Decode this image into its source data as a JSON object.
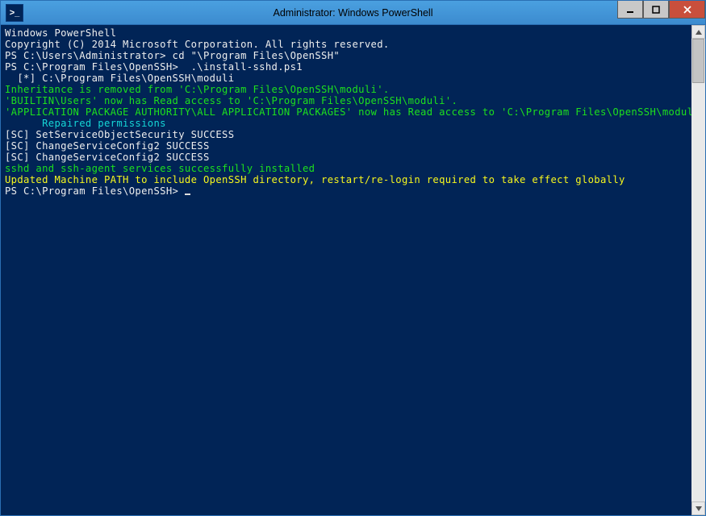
{
  "window": {
    "title": "Administrator: Windows PowerShell",
    "icon_glyph": ">_"
  },
  "terminal": {
    "lines": [
      {
        "cls": "l-white",
        "text": "Windows PowerShell"
      },
      {
        "cls": "l-white",
        "text": "Copyright (C) 2014 Microsoft Corporation. All rights reserved."
      },
      {
        "cls": "l-white",
        "text": ""
      },
      {
        "cls": "l-white",
        "text": "PS C:\\Users\\Administrator> cd \"\\Program Files\\OpenSSH\""
      },
      {
        "cls": "l-white",
        "text": "PS C:\\Program Files\\OpenSSH>  .\\install-sshd.ps1"
      },
      {
        "cls": "l-white",
        "text": "  [*] C:\\Program Files\\OpenSSH\\moduli"
      },
      {
        "cls": "l-green",
        "text": "Inheritance is removed from 'C:\\Program Files\\OpenSSH\\moduli'."
      },
      {
        "cls": "l-green",
        "text": "'BUILTIN\\Users' now has Read access to 'C:\\Program Files\\OpenSSH\\moduli'."
      },
      {
        "cls": "l-green",
        "text": "'APPLICATION PACKAGE AUTHORITY\\ALL APPLICATION PACKAGES' now has Read access to 'C:\\Program Files\\OpenSSH\\moduli'."
      },
      {
        "cls": "l-cyan",
        "text": "      Repaired permissions"
      },
      {
        "cls": "l-white",
        "text": ""
      },
      {
        "cls": "l-white",
        "text": "[SC] SetServiceObjectSecurity SUCCESS"
      },
      {
        "cls": "l-white",
        "text": "[SC] ChangeServiceConfig2 SUCCESS"
      },
      {
        "cls": "l-white",
        "text": "[SC] ChangeServiceConfig2 SUCCESS"
      },
      {
        "cls": "l-green",
        "text": "sshd and ssh-agent services successfully installed"
      },
      {
        "cls": "l-yellow",
        "text": "Updated Machine PATH to include OpenSSH directory, restart/re-login required to take effect globally"
      }
    ],
    "prompt": "PS C:\\Program Files\\OpenSSH> "
  }
}
